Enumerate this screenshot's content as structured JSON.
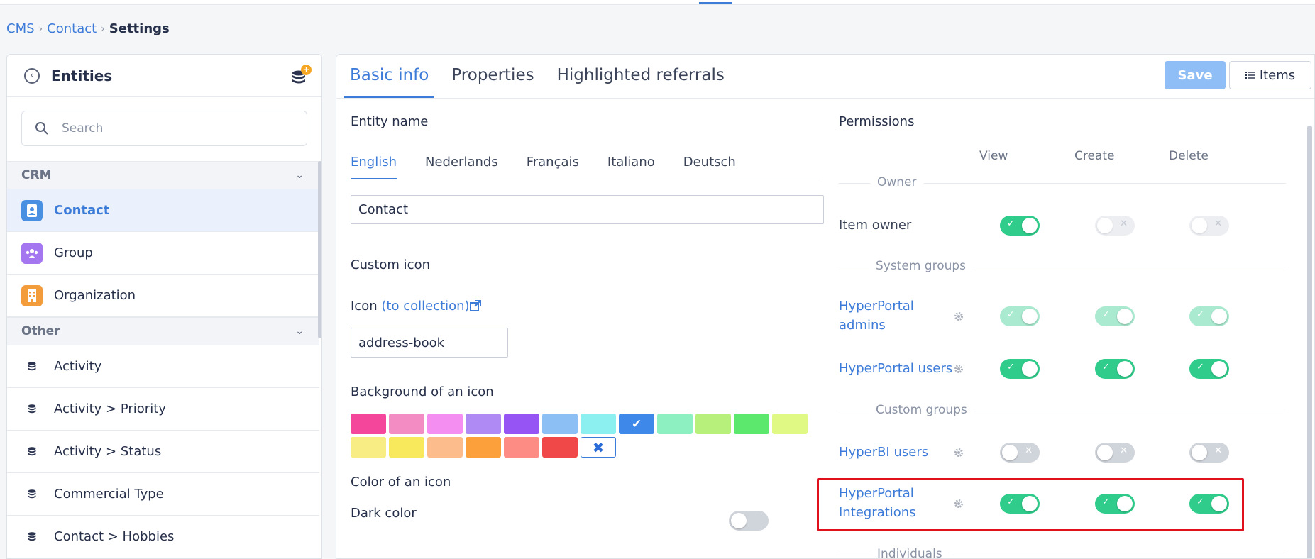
{
  "breadcrumb": {
    "root": "CMS",
    "parent": "Contact",
    "current": "Settings"
  },
  "sidebar": {
    "title": "Entities",
    "search_placeholder": "Search",
    "groups": [
      {
        "label": "CRM",
        "items": [
          {
            "label": "Contact",
            "icon": "address-book-icon",
            "color": "#4a90e2",
            "active": true
          },
          {
            "label": "Group",
            "icon": "users-icon",
            "color": "#a476f0"
          },
          {
            "label": "Organization",
            "icon": "building-icon",
            "color": "#f39c3c"
          }
        ]
      },
      {
        "label": "Other",
        "items": [
          {
            "label": "Activity",
            "icon": "database-icon"
          },
          {
            "label": "Activity > Priority",
            "icon": "database-icon"
          },
          {
            "label": "Activity > Status",
            "icon": "database-icon"
          },
          {
            "label": "Commercial Type",
            "icon": "database-icon"
          },
          {
            "label": "Contact > Hobbies",
            "icon": "database-icon"
          }
        ]
      }
    ]
  },
  "tabs": [
    {
      "label": "Basic info",
      "active": true
    },
    {
      "label": "Properties"
    },
    {
      "label": "Highlighted referrals"
    }
  ],
  "toolbar": {
    "save_label": "Save",
    "items_label": "Items"
  },
  "basic_info": {
    "entity_name_label": "Entity name",
    "languages": [
      "English",
      "Nederlands",
      "Français",
      "Italiano",
      "Deutsch"
    ],
    "active_language": "English",
    "entity_name_value": "Contact",
    "custom_icon_label": "Custom icon",
    "icon_label": "Icon",
    "icon_collection_link": "(to collection)",
    "icon_value": "address-book",
    "background_label": "Background of an icon",
    "swatch_colors_row1": [
      "#f4479c",
      "#f48cc4",
      "#f48ef0",
      "#b08af4",
      "#9654f4",
      "#8cc0f4",
      "#8cf0f0",
      "#3d88e8",
      "#8cf0c0",
      "#b8f07c",
      "#5ce86c",
      "#e0f884"
    ],
    "swatch_colors_row2": [
      "#f8ec84",
      "#f8e85c",
      "#fcbc8c",
      "#fca03c",
      "#fc8c84",
      "#f04848"
    ],
    "selected_swatch": "#3d88e8",
    "color_label": "Color of an icon",
    "dark_color_label": "Dark color"
  },
  "permissions": {
    "title": "Permissions",
    "columns": [
      "View",
      "Create",
      "Delete"
    ],
    "sections": {
      "owner": "Owner",
      "system": "System groups",
      "custom": "Custom groups",
      "individuals": "Individuals"
    },
    "rows": {
      "item_owner": {
        "label": "Item owner",
        "view": true,
        "create": false,
        "delete": false
      },
      "hp_admins": {
        "label": "HyperPortal admins",
        "line1": "HyperPortal",
        "line2": "admins",
        "view": true,
        "create": true,
        "delete": true
      },
      "hp_users": {
        "label": "HyperPortal users",
        "view": true,
        "create": true,
        "delete": true
      },
      "hyperbi_users": {
        "label": "HyperBI users",
        "view": false,
        "create": false,
        "delete": false
      },
      "hp_integrations": {
        "label": "HyperPortal Integrations",
        "line1": "HyperPortal",
        "line2": "Integrations",
        "view": true,
        "create": true,
        "delete": true
      }
    }
  }
}
